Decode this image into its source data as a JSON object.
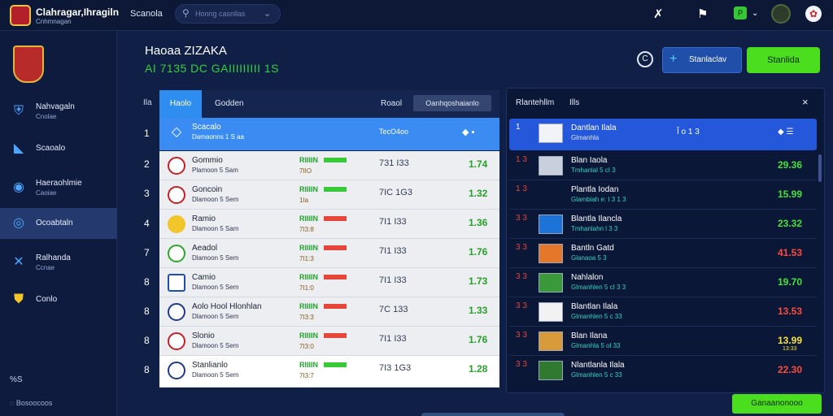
{
  "header": {
    "brand_title": "Clahragar,Ihragiln",
    "brand_sub": "Cnhmnagan",
    "nav_label": "Scanola",
    "search_placeholder": "Honng casnllas",
    "search_icon": "search-icon",
    "icons": [
      "trophy-icon",
      "flag-icon",
      "green-badge-icon",
      "avatar",
      "settings-icon"
    ],
    "badge_text": "P",
    "chevron": "⌄"
  },
  "sidebar": {
    "items": [
      {
        "label": "Nahvagaln",
        "sub": "Cnolae"
      },
      {
        "label": "Scaoalo",
        "sub": ""
      },
      {
        "label": "Haeraohlmie",
        "sub": "Caoiae"
      },
      {
        "label": "Ocoabtaln",
        "sub": ""
      },
      {
        "label": "Ralhanda",
        "sub": "Ccnae"
      },
      {
        "label": "Conlo",
        "sub": ""
      }
    ],
    "active_index": 3,
    "footer1": "%S",
    "footer2": "Bosoocoos"
  },
  "main": {
    "title": "Haoaa ZIZAKA",
    "subtitle": "AI 7135 DC GAIIIIIIIII 1S",
    "info_label": "C",
    "add_button_label": "Stanlaclav",
    "green_button_label": "Stanlida",
    "ranks": [
      "1",
      "2",
      "3",
      "4",
      "7",
      "8",
      "8",
      "8",
      "8"
    ],
    "rank_header": "Ila"
  },
  "left_panel": {
    "tabs": [
      "Haolo",
      "Godden",
      "Roaol",
      "Oanhqoshaianlo"
    ],
    "selected_row": {
      "name": "Scacalo",
      "sub": "Damaonns 1 S aa",
      "score": "TecO4oo",
      "icons": "◆ ▪"
    },
    "rows": [
      {
        "name": "Gommio",
        "sub": "Plamoon 5 Sam",
        "tag": "RIIIIN",
        "bar": "green",
        "tag2": "7IIO",
        "score": "731 I33",
        "value": "1.74"
      },
      {
        "name": "Goncoin",
        "sub": "Dlamoon 5 Sem",
        "tag": "RIIIIN",
        "bar": "green",
        "tag2": "1Ia",
        "score": "7IC 1G3",
        "value": "1.32"
      },
      {
        "name": "Ramio",
        "sub": "Dlamoon 5 Sam",
        "tag": "RIIIIN",
        "bar": "red",
        "tag2": "7I3:8",
        "score": "7I1 I33",
        "value": "1.36"
      },
      {
        "name": "Aeadol",
        "sub": "Dlamoon 5 Sem",
        "tag": "RIIIIN",
        "bar": "red",
        "tag2": "7I1:3",
        "score": "7I1 I33",
        "value": "1.76"
      },
      {
        "name": "Camio",
        "sub": "Dlamoon 5 Sem",
        "tag": "RIIIIN",
        "bar": "red",
        "tag2": "7I1:0",
        "score": "7I1 I33",
        "value": "1.73"
      },
      {
        "name": "Aolo Hool Hlonhlan",
        "sub": "Dlamoon 5 Sem",
        "tag": "RIIIIN",
        "bar": "red",
        "tag2": "7I3:3",
        "score": "7C 133",
        "value": "1.33"
      },
      {
        "name": "Slonio",
        "sub": "Dlamoon 5 Sem",
        "tag": "RIIIIN",
        "bar": "red",
        "tag2": "7I3:0",
        "score": "7I1 I33",
        "value": "1.76"
      },
      {
        "name": "Stanlianlo",
        "sub": "Dlamoon 5 Sem",
        "tag": "RIIIIN",
        "bar": "green",
        "tag2": "7I3:7",
        "score": "7I3 1G3",
        "value": "1.28"
      }
    ]
  },
  "right_panel": {
    "header1": "Rlantehllm",
    "header2": "Ills",
    "close_icon": "×",
    "selected_row": {
      "rank": "1",
      "name": "Dantlan Ilala",
      "sub": "Glmanhla",
      "mid": "Ǐ o 1 3",
      "icons": "◆ ☰"
    },
    "rows": [
      {
        "rank": "1 3",
        "name": "Blan Iaola",
        "sub": "Tmhanlal 5 cI 3",
        "value": "29.36",
        "color": "green",
        "value2": ""
      },
      {
        "rank": "1 3",
        "name": "Plantla Iodan",
        "sub": "Glambiah e: I 3 1 3",
        "value": "15.99",
        "color": "green",
        "value2": ""
      },
      {
        "rank": "3 3",
        "name": "Blantla Ilancla",
        "sub": "Tmhanlahn l 3 3",
        "value": "23.32",
        "color": "green",
        "value2": ""
      },
      {
        "rank": "3 3",
        "name": "Bantln Gatd",
        "sub": "Glanaoa 5 3",
        "value": "41.53",
        "color": "red",
        "value2": ""
      },
      {
        "rank": "3 3",
        "name": "Nahlalon",
        "sub": "Glmanhlen 5 cI 3 3",
        "value": "19.70",
        "color": "green",
        "value2": ""
      },
      {
        "rank": "3 3",
        "name": "Blantlan Ilala",
        "sub": "Glmanhlen 5 c 33",
        "value": "13.53",
        "color": "red",
        "value2": ""
      },
      {
        "rank": "3 3",
        "name": "Blan Ilana",
        "sub": "Glmanhla 5 ol 33",
        "value": "13.99",
        "color": "yellow",
        "value2": "13:33"
      },
      {
        "rank": "3 3",
        "name": "Nlantlanla Ilala",
        "sub": "Glmanhlen 5 c 33",
        "value": "22.30",
        "color": "red",
        "value2": ""
      }
    ]
  },
  "footer": {
    "bottom_button_label": "Ganaanonooo"
  },
  "colors": {
    "accent_green": "#4bde1e",
    "accent_blue": "#2f8df0",
    "background": "#0f1f45",
    "value_green": "#41e33b",
    "value_red": "#ff4a3d"
  }
}
